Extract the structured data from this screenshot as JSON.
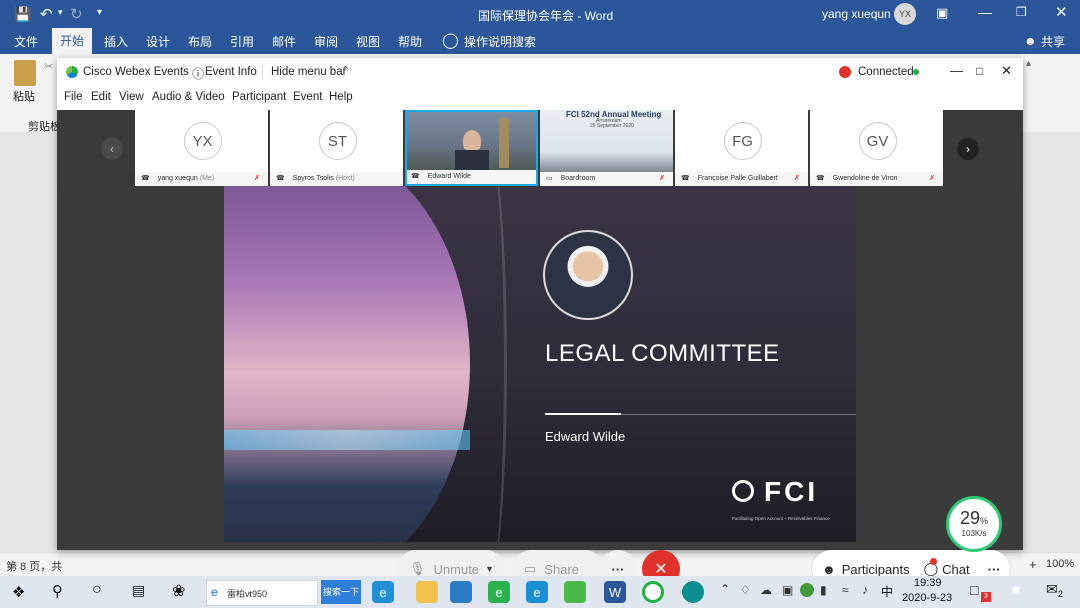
{
  "word": {
    "title": "国际保理协会年会 - Word",
    "user": "yang xuequn",
    "user_initials": "YX",
    "tabs": [
      "文件",
      "开始",
      "插入",
      "设计",
      "布局",
      "引用",
      "邮件",
      "审阅",
      "视图",
      "帮助"
    ],
    "active_tab": "开始",
    "tell_me": "操作说明搜索",
    "share": "共享",
    "paste": "粘贴",
    "clipboard": "剪贴板",
    "status_page": "第 8 页，共",
    "zoom": "100%",
    "zoom_plus": "+"
  },
  "webex": {
    "app_name": "Cisco Webex Events",
    "event_info": "Event Info",
    "hide_menu": "Hide menu bar",
    "status": "Connected",
    "menu": [
      "File",
      "Edit",
      "View",
      "Audio & Video",
      "Participant",
      "Event",
      "Help"
    ],
    "participants": [
      {
        "initials": "YX",
        "name": "yang xuequn",
        "tag": "(Me)",
        "video": false
      },
      {
        "initials": "ST",
        "name": "Spyros Tsolis",
        "tag": "(Host)",
        "video": false
      },
      {
        "initials": "",
        "name": "Edward Wilde",
        "tag": "",
        "video": true
      },
      {
        "initials": "",
        "name": "Boardroom",
        "tag": "",
        "video": true
      },
      {
        "initials": "FG",
        "name": "Françoise Palle Guillabert",
        "tag": "",
        "video": false
      },
      {
        "initials": "GV",
        "name": "Gwendoline de Viron",
        "tag": "",
        "video": false
      }
    ],
    "slide": {
      "title": "LEGAL COMMITTEE",
      "speaker": "Edward Wilde",
      "logo": "FCI",
      "logo_tag": "Facilitating Open Account – Receivables Finance",
      "meeting_title": "FCI 52nd Annual Meeting",
      "meeting_sub": "Amsterdam",
      "meeting_date": "29 September 2020"
    },
    "controls": {
      "unmute": "Unmute",
      "share": "Share",
      "more": "···",
      "participants": "Participants",
      "chat": "Chat",
      "more_right": "···"
    },
    "net_widget": {
      "percent": "29",
      "unit": "%",
      "speed": "103K/s"
    }
  },
  "taskbar": {
    "search_placeholder": "雷柏vt950",
    "search_button": "搜索一下",
    "time": "19:39",
    "date": "2020-9-23",
    "ime": "中",
    "notification_count": "2",
    "badge": "3"
  },
  "colors": {
    "word_blue": "#2b579a",
    "end_red": "#e0322b",
    "webex_green": "#2ecc71",
    "status_green": "#1fb141"
  }
}
